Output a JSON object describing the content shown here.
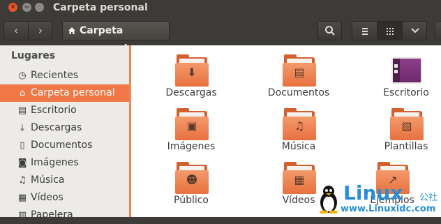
{
  "window": {
    "title": "Carpeta personal",
    "buttons": {
      "close": "×",
      "minimize": "−",
      "maximize": ""
    }
  },
  "toolbar": {
    "back_icon": "‹",
    "forward_icon": "›",
    "breadcrumb": {
      "icon": "home-icon",
      "label": "Carpeta personal"
    },
    "search_icon": "search-icon",
    "view_list_icon": "≡",
    "view_grid_icon": "⁞⁞⁞",
    "view_options_icon": "⌄"
  },
  "sidebar": {
    "heading": "Lugares",
    "items": [
      {
        "label": "Recientes",
        "icon": "clock-icon",
        "glyph": "◷",
        "selected": false
      },
      {
        "label": "Carpeta personal",
        "icon": "home-icon",
        "glyph": "⌂",
        "selected": true
      },
      {
        "label": "Escritorio",
        "icon": "desktop-icon",
        "glyph": "▤",
        "selected": false
      },
      {
        "label": "Descargas",
        "icon": "download-icon",
        "glyph": "⤓",
        "selected": false
      },
      {
        "label": "Documentos",
        "icon": "document-icon",
        "glyph": "▯",
        "selected": false
      },
      {
        "label": "Imágenes",
        "icon": "camera-icon",
        "glyph": "◙",
        "selected": false
      },
      {
        "label": "Música",
        "icon": "music-icon",
        "glyph": "♫",
        "selected": false
      },
      {
        "label": "Vídeos",
        "icon": "film-icon",
        "glyph": "▦",
        "selected": false
      },
      {
        "label": "Papelera",
        "icon": "trash-icon",
        "glyph": "▥",
        "selected": false
      }
    ]
  },
  "items": [
    {
      "name": "Descargas",
      "icon": "folder-download-icon",
      "emblem": "⬇"
    },
    {
      "name": "Documentos",
      "icon": "folder-documents-icon",
      "emblem": "▤"
    },
    {
      "name": "Escritorio",
      "icon": "desktop-folder-icon",
      "emblem": ""
    },
    {
      "name": "Imágenes",
      "icon": "folder-pictures-icon",
      "emblem": "▣"
    },
    {
      "name": "Música",
      "icon": "folder-music-icon",
      "emblem": "♫"
    },
    {
      "name": "Plantillas",
      "icon": "folder-templates-icon",
      "emblem": "▧"
    },
    {
      "name": "Público",
      "icon": "folder-public-icon",
      "emblem": "☻"
    },
    {
      "name": "Vídeos",
      "icon": "folder-videos-icon",
      "emblem": "▦"
    },
    {
      "name": "Ejemplos",
      "icon": "folder-examples-icon",
      "emblem": "↗"
    }
  ],
  "watermark": {
    "brand": "Linux",
    "brand_suffix": "公社",
    "url": "www.Linuxidc.com"
  },
  "colors": {
    "accent": "#f07746",
    "folder": "#e7713f",
    "titlebar": "#3c3b37",
    "watermark": "#2a8ed6"
  }
}
